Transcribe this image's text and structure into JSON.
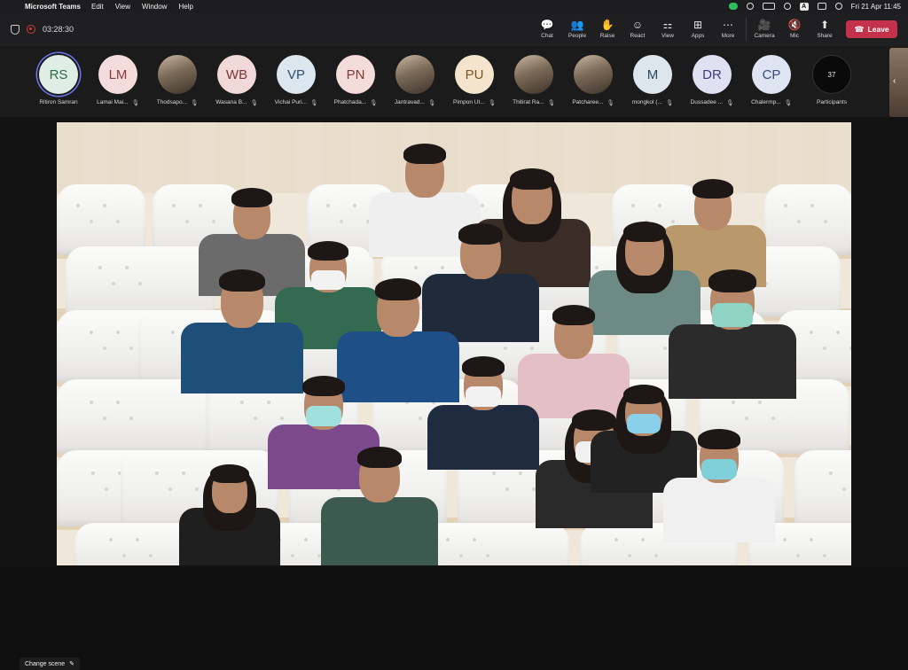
{
  "menubar": {
    "app_name": "Microsoft Teams",
    "menus": [
      "Edit",
      "View",
      "Window",
      "Help"
    ],
    "datetime": "Fri 21 Apr  11:45"
  },
  "meeting": {
    "elapsed": "03:28:30",
    "controls": [
      {
        "label": "Chat",
        "icon": "chat-icon",
        "glyph": "💬"
      },
      {
        "label": "People",
        "icon": "people-icon",
        "glyph": "👥"
      },
      {
        "label": "Raise",
        "icon": "raise-hand-icon",
        "glyph": "✋"
      },
      {
        "label": "React",
        "icon": "react-icon",
        "glyph": "☺"
      },
      {
        "label": "View",
        "icon": "view-icon",
        "glyph": "⚏"
      },
      {
        "label": "Apps",
        "icon": "apps-icon",
        "glyph": "⊞"
      },
      {
        "label": "More",
        "icon": "more-icon",
        "glyph": "⋯"
      }
    ],
    "media_controls": [
      {
        "label": "Camera",
        "icon": "camera-icon",
        "glyph": "🎥"
      },
      {
        "label": "Mic",
        "icon": "mic-muted-icon",
        "glyph": "🔇"
      },
      {
        "label": "Share",
        "icon": "share-icon",
        "glyph": "⬆"
      }
    ],
    "leave_label": "Leave",
    "accent": "#c4314b"
  },
  "participants": [
    {
      "initials": "RS",
      "name": "Ritiron Samran",
      "bg": "#dfeee4",
      "fg": "#2f6b45",
      "selected": true,
      "muted": false
    },
    {
      "initials": "LM",
      "name": "Lamai Mai...",
      "bg": "#f4dcdc",
      "fg": "#8a3a3a",
      "muted": true
    },
    {
      "initials": "",
      "name": "Thodsapo...",
      "photo": true,
      "muted": true
    },
    {
      "initials": "WB",
      "name": "Wasana B...",
      "bg": "#f1d9d9",
      "fg": "#7e3434",
      "muted": true
    },
    {
      "initials": "VP",
      "name": "Vichai Puri...",
      "bg": "#dce6ee",
      "fg": "#2f4f6b",
      "muted": true
    },
    {
      "initials": "PN",
      "name": "Phatchada...",
      "bg": "#f3dcd9",
      "fg": "#7e3a34",
      "muted": true
    },
    {
      "initials": "",
      "name": "Jantravad...",
      "photo": true,
      "muted": true
    },
    {
      "initials": "PU",
      "name": "Pimpon Ut...",
      "bg": "#f5e4cd",
      "fg": "#7a5320",
      "muted": true
    },
    {
      "initials": "",
      "name": "Thitirat Ra...",
      "photo": true,
      "muted": true
    },
    {
      "initials": "",
      "name": "Patcharee...",
      "photo": true,
      "muted": true
    },
    {
      "initials": "M",
      "name": "mongkol (...",
      "bg": "#dde6ec",
      "fg": "#2f4a5e",
      "muted": true
    },
    {
      "initials": "DR",
      "name": "Dussadee ...",
      "bg": "#dfe0f1",
      "fg": "#3c3f7a",
      "muted": true
    },
    {
      "initials": "CP",
      "name": "Chalermp...",
      "bg": "#dfe4f2",
      "fg": "#3a4a7a",
      "muted": true
    }
  ],
  "participant_count": "37",
  "participants_label": "Participants",
  "change_scene_label": "Change scene"
}
